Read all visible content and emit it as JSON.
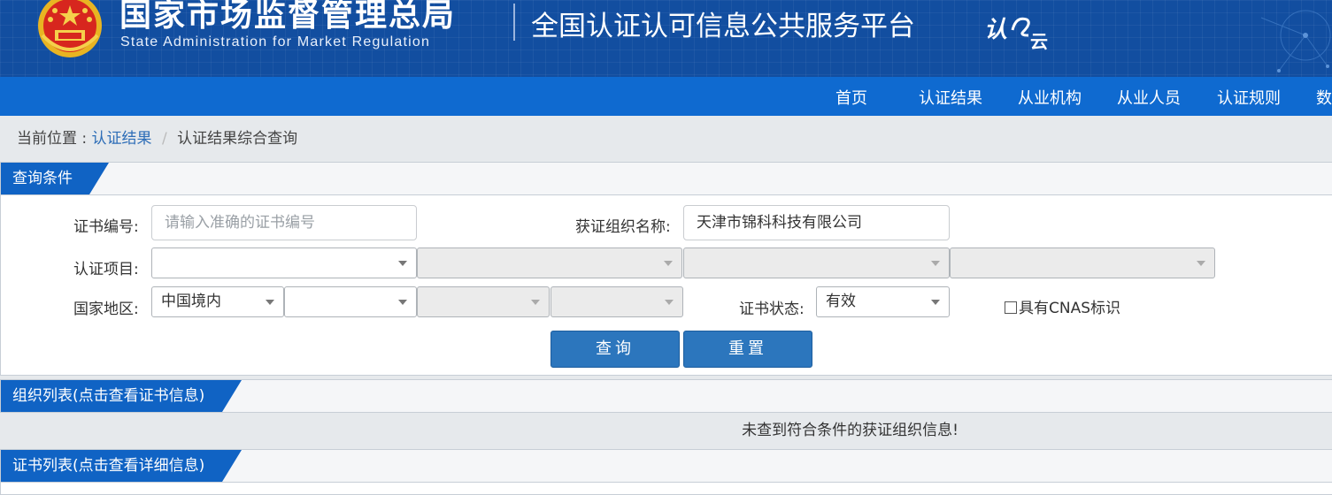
{
  "header": {
    "agency_cn": "国家市场监督管理总局",
    "agency_en": "State Administration  for  Market Regulation",
    "platform_title": "全国认证认可信息公共服务平台",
    "logo_text": "认",
    "logo_text2": "云"
  },
  "nav": {
    "items": [
      "首页",
      "认证结果",
      "从业机构",
      "从业人员",
      "认证规则",
      "数"
    ]
  },
  "breadcrumb": {
    "prefix": "当前位置 :",
    "link": "认证结果",
    "separator": "/",
    "current": "认证结果综合查询"
  },
  "query": {
    "tab": "查询条件",
    "cert_no_label": "证书编号:",
    "cert_no_placeholder": "请输入准确的证书编号",
    "org_name_label": "获证组织名称:",
    "org_name_value": "天津市锦科科技有限公司",
    "project_label": "认证项目:",
    "region_label": "国家地区:",
    "region_value": "中国境内",
    "status_label": "证书状态:",
    "status_value": "有效",
    "cnas_label": "具有CNAS标识",
    "search_button": "查询",
    "reset_button": "重置"
  },
  "org_list": {
    "tab": "组织列表(点击查看证书信息)",
    "empty_message": "未查到符合条件的获证组织信息!"
  },
  "cert_list": {
    "tab": "证书列表(点击查看详细信息)"
  },
  "colors": {
    "header_bg": "#124ea0",
    "nav_bg": "#0f6ad0",
    "tab_bg": "#1063c4",
    "button_bg": "#2c76bd",
    "link": "#2d6db7"
  }
}
